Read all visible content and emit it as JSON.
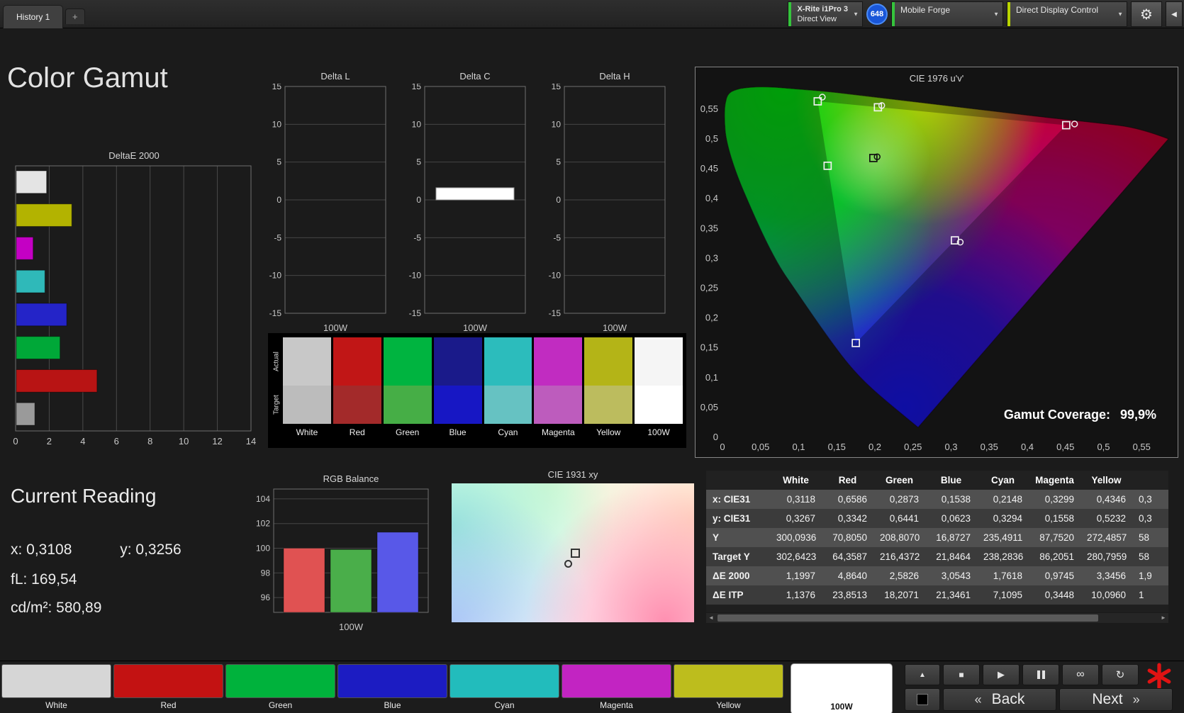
{
  "page_title": "Color Gamut",
  "top_bar": {
    "history_tab": "History 1",
    "new_tab": "+",
    "meter_line1": "X-Rite i1Pro 3",
    "meter_line2": "Direct View",
    "meter_count": "648",
    "source_label": "Mobile Forge",
    "display_control_label": "Direct Display Control",
    "dropdown_chevron": "▼",
    "gear_icon": "⚙",
    "collapse_icon": "◀"
  },
  "current_reading": {
    "title": "Current Reading",
    "x": "x: 0,3108",
    "y": "y: 0,3256",
    "fl": "fL: 169,54",
    "cd": "cd/m²: 580,89"
  },
  "gamut_coverage": {
    "label": "Gamut Coverage:",
    "value": "99,9%"
  },
  "chart_data": [
    {
      "id": "deltae2000",
      "type": "bar",
      "orientation": "horizontal",
      "title": "DeltaE 2000",
      "categories": [
        "100W",
        "Yellow",
        "Magenta",
        "Cyan",
        "Blue",
        "Green",
        "Red",
        "White"
      ],
      "values": [
        1.8,
        3.3,
        1.0,
        1.7,
        3.0,
        2.6,
        4.8,
        1.1
      ],
      "bar_colors": [
        "#e4e4e4",
        "#b3b300",
        "#c400c4",
        "#2fb9b9",
        "#2424c8",
        "#00a838",
        "#b81414",
        "#9a9a9a"
      ],
      "xlim": [
        0,
        14
      ],
      "xticks": [
        "0",
        "2",
        "4",
        "6",
        "8",
        "10",
        "12",
        "14"
      ],
      "grid": true
    },
    {
      "id": "delta_l",
      "type": "bar",
      "title": "Delta L",
      "categories": [
        "100W"
      ],
      "values": [
        0
      ],
      "ylim": [
        -15,
        15
      ],
      "yticks": [
        "15",
        "10",
        "5",
        "0",
        "-5",
        "-10",
        "-15"
      ],
      "xlabel": "100W",
      "bar_color": "#ffffff"
    },
    {
      "id": "delta_c",
      "type": "bar",
      "title": "Delta C",
      "categories": [
        "100W"
      ],
      "values": [
        1.6
      ],
      "ylim": [
        -15,
        15
      ],
      "yticks": [
        "15",
        "10",
        "5",
        "0",
        "-5",
        "-10",
        "-15"
      ],
      "xlabel": "100W",
      "bar_color": "#ffffff"
    },
    {
      "id": "delta_h",
      "type": "bar",
      "title": "Delta H",
      "categories": [
        "100W"
      ],
      "values": [
        0
      ],
      "ylim": [
        -15,
        15
      ],
      "yticks": [
        "15",
        "10",
        "5",
        "0",
        "-5",
        "-10",
        "-15"
      ],
      "xlabel": "100W",
      "bar_color": "#ffffff"
    },
    {
      "id": "rgb_balance",
      "type": "bar",
      "title": "RGB Balance",
      "categories": [
        "Red",
        "Green",
        "Blue"
      ],
      "values": [
        100.0,
        99.9,
        101.3
      ],
      "bar_colors": [
        "#e05252",
        "#4aae4a",
        "#5858e8"
      ],
      "ylim": [
        94.8,
        104.8
      ],
      "yticks": [
        "104",
        "102",
        "100",
        "98",
        "96"
      ],
      "xlabel": "100W"
    },
    {
      "id": "cie1976",
      "type": "scatter",
      "title": "CIE 1976 u'v'",
      "xticks": [
        "0",
        "0,05",
        "0,1",
        "0,15",
        "0,2",
        "0,25",
        "0,3",
        "0,35",
        "0,4",
        "0,45",
        "0,5",
        "0,55"
      ],
      "yticks": [
        "0,55",
        "0,5",
        "0,45",
        "0,4",
        "0,35",
        "0,3",
        "0,25",
        "0,2",
        "0,15",
        "0,1",
        "0,05",
        "0"
      ],
      "gamut_triangle": {
        "red": [
          0.451,
          0.523
        ],
        "green": [
          0.125,
          0.563
        ],
        "blue": [
          0.175,
          0.158
        ]
      },
      "target_points": [
        {
          "name": "white",
          "u": 0.198,
          "v": 0.468
        },
        {
          "name": "red",
          "u": 0.451,
          "v": 0.523
        },
        {
          "name": "green",
          "u": 0.125,
          "v": 0.563
        },
        {
          "name": "blue",
          "u": 0.175,
          "v": 0.158
        },
        {
          "name": "cyan",
          "u": 0.138,
          "v": 0.455
        },
        {
          "name": "magenta",
          "u": 0.305,
          "v": 0.33
        },
        {
          "name": "yellow",
          "u": 0.204,
          "v": 0.553
        }
      ],
      "measured_points": [
        {
          "name": "white",
          "u": 0.203,
          "v": 0.47
        },
        {
          "name": "red",
          "u": 0.462,
          "v": 0.525
        },
        {
          "name": "green",
          "u": 0.131,
          "v": 0.57
        },
        {
          "name": "yellow",
          "u": 0.209,
          "v": 0.556
        },
        {
          "name": "magenta",
          "u": 0.312,
          "v": 0.327
        }
      ]
    },
    {
      "id": "cie1931",
      "type": "scatter",
      "title": "CIE 1931 xy",
      "points": [
        {
          "name": "target",
          "x": 0.3127,
          "y": 0.329
        },
        {
          "name": "measured",
          "x": 0.3108,
          "y": 0.3256
        }
      ]
    },
    {
      "id": "results_table",
      "type": "table",
      "columns": [
        "",
        "White",
        "Red",
        "Green",
        "Blue",
        "Cyan",
        "Magenta",
        "Yellow",
        ""
      ],
      "rows": [
        {
          "label": "x: CIE31",
          "values": [
            "0,3118",
            "0,6586",
            "0,2873",
            "0,1538",
            "0,2148",
            "0,3299",
            "0,4346",
            "0,3"
          ]
        },
        {
          "label": "y: CIE31",
          "values": [
            "0,3267",
            "0,3342",
            "0,6441",
            "0,0623",
            "0,3294",
            "0,1558",
            "0,5232",
            "0,3"
          ]
        },
        {
          "label": "Y",
          "values": [
            "300,0936",
            "70,8050",
            "208,8070",
            "16,8727",
            "235,4911",
            "87,7520",
            "272,4857",
            "58"
          ]
        },
        {
          "label": "Target Y",
          "values": [
            "302,6423",
            "64,3587",
            "216,4372",
            "21,8464",
            "238,2836",
            "86,2051",
            "280,7959",
            "58"
          ]
        },
        {
          "label": "ΔE 2000",
          "values": [
            "1,1997",
            "4,8640",
            "2,5826",
            "3,0543",
            "1,7618",
            "0,9745",
            "3,3456",
            "1,9"
          ]
        },
        {
          "label": "ΔE ITP",
          "values": [
            "1,1376",
            "23,8513",
            "18,2071",
            "21,3461",
            "7,1095",
            "0,3448",
            "10,0960",
            "1"
          ]
        }
      ]
    }
  ],
  "comparison_strip": {
    "row_labels": [
      "Actual",
      "Target"
    ],
    "columns": [
      "White",
      "Red",
      "Green",
      "Blue",
      "Cyan",
      "Magenta",
      "Yellow",
      "100W"
    ],
    "actual_colors": [
      "#c8c8c8",
      "#c11616",
      "#00b440",
      "#1a1a8a",
      "#2cbcbc",
      "#c12cc1",
      "#b4b417",
      "#f5f5f5"
    ],
    "target_colors": [
      "#bcbcbc",
      "#a32a2a",
      "#46ae46",
      "#1717c4",
      "#66c2c2",
      "#bd5cbd",
      "#bcbc5e",
      "#ffffff"
    ]
  },
  "table_scrollbar": {
    "left_arrow": "◄",
    "right_arrow": "►"
  },
  "bottom_bar": {
    "patches": [
      {
        "label": "White",
        "color": "#d6d6d6",
        "selected": false
      },
      {
        "label": "Red",
        "color": "#c31212",
        "selected": false
      },
      {
        "label": "Green",
        "color": "#00b23c",
        "selected": false
      },
      {
        "label": "Blue",
        "color": "#1c1cc2",
        "selected": false
      },
      {
        "label": "Cyan",
        "color": "#22bcbc",
        "selected": false
      },
      {
        "label": "Magenta",
        "color": "#c224c2",
        "selected": false
      },
      {
        "label": "Yellow",
        "color": "#bdbd1d",
        "selected": false
      },
      {
        "label": "100W",
        "color": "#ffffff",
        "selected": true
      }
    ],
    "icons": {
      "up": "▲",
      "blackout": "black-square",
      "stop": "■",
      "play": "▶",
      "pause": "pause-bars",
      "loop": "∞",
      "refresh": "↻"
    },
    "back_chevron": "«",
    "back": "Back",
    "next": "Next",
    "next_chevron": "»"
  }
}
